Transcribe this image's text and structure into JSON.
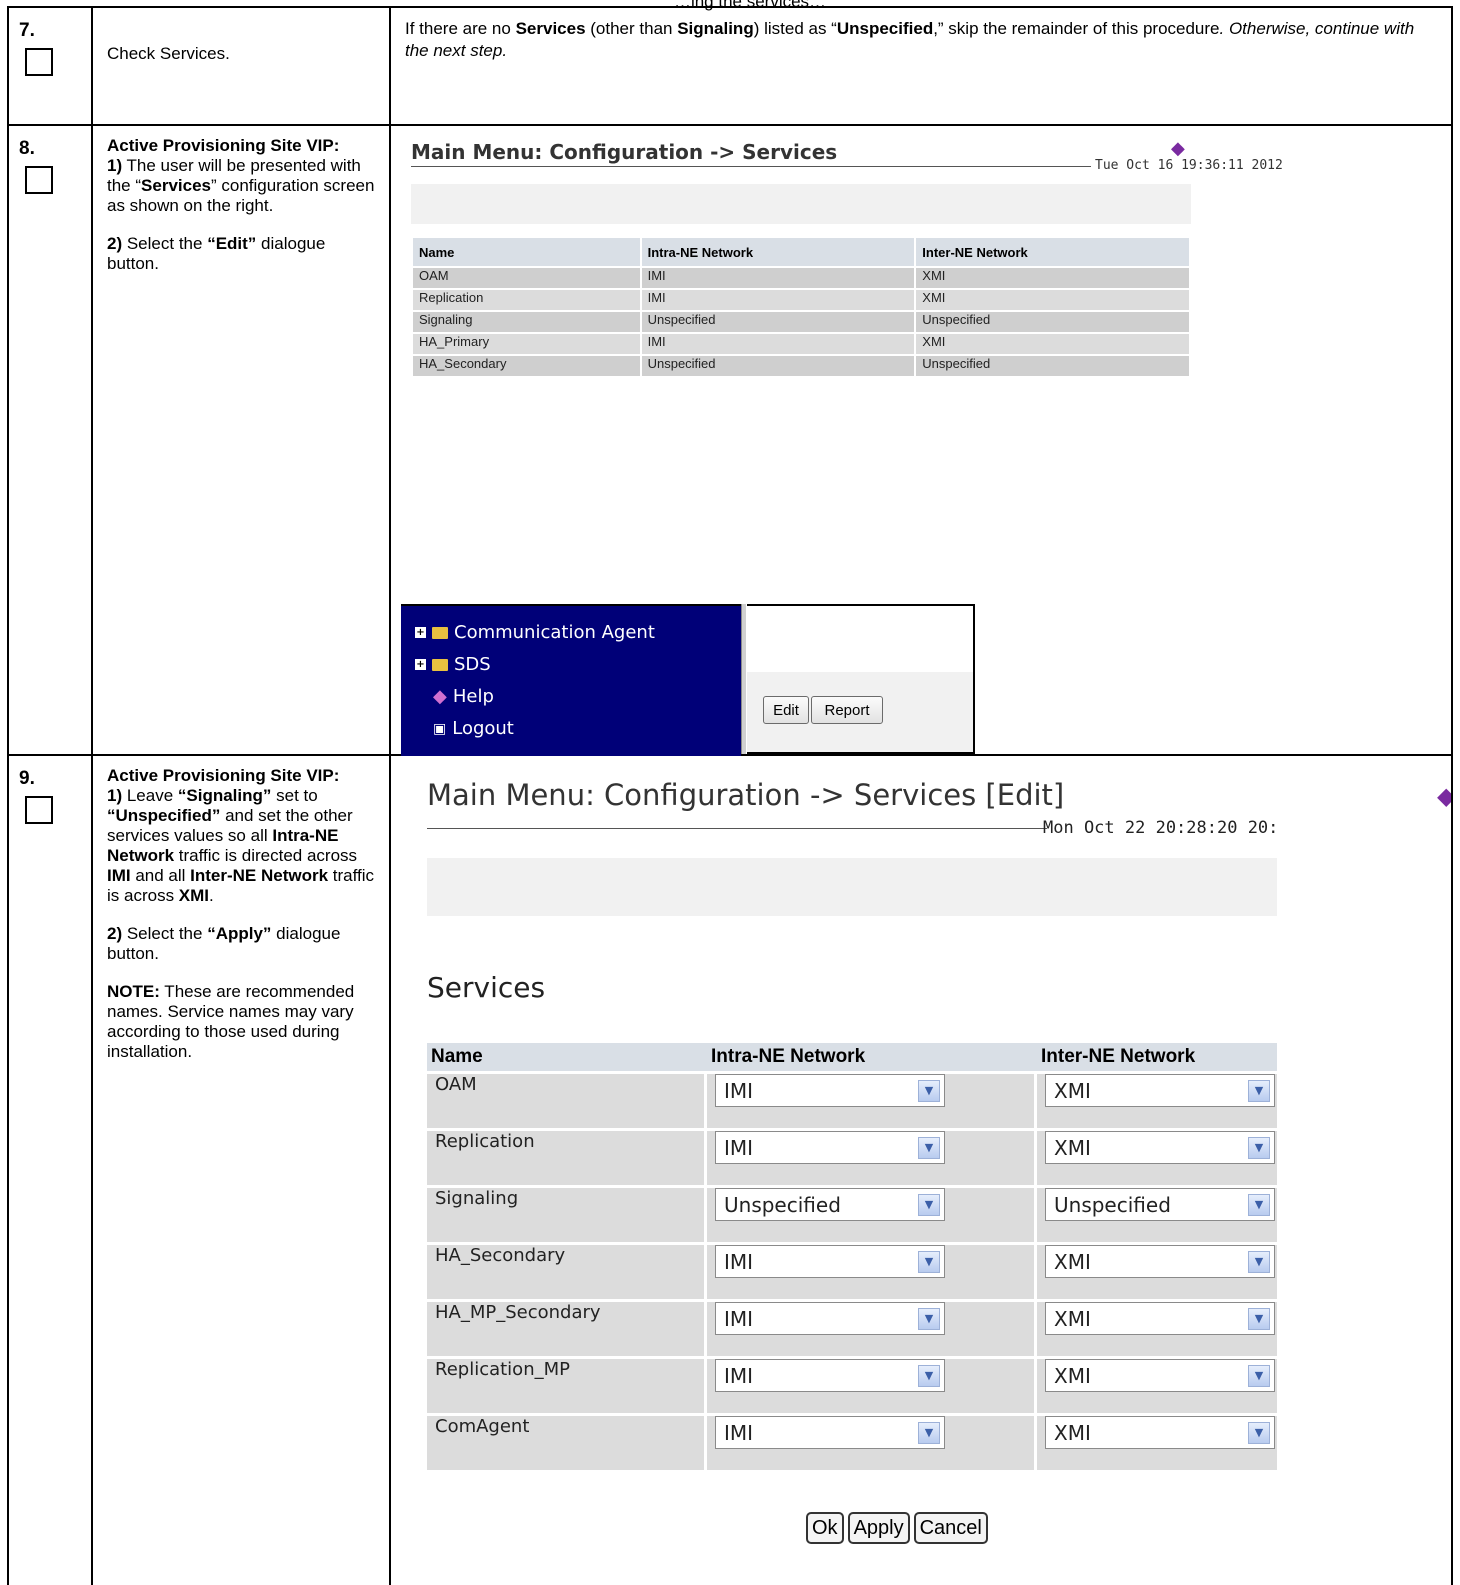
{
  "partial_top": "…ing the services…",
  "steps": [
    {
      "num": "7.",
      "title": "Check Services.",
      "desc_parts": [
        "If there are no ",
        "Services",
        " (other than ",
        "Signaling",
        ") listed as “",
        "Unspecified",
        ",” skip the remainder of this procedure",
        ". Otherwise, continue with the next step."
      ]
    },
    {
      "num": "8.",
      "heading": "Active Provisioning Site VIP:",
      "i1": [
        "1)",
        " The user will be presented with the “",
        "Services",
        "” configuration screen as shown on the right."
      ],
      "i2": [
        "2)",
        " Select the ",
        "“Edit”",
        " dialogue button."
      ]
    },
    {
      "num": "9.",
      "heading": "Active Provisioning Site VIP:",
      "i1": [
        "1)",
        " Leave ",
        "“Signaling”",
        " set to ",
        "“Unspecified”",
        " and set the other services values so all ",
        "Intra-NE Network",
        " traffic is directed across ",
        "IMI",
        " and all ",
        "Inter-NE Network",
        " traffic is across ",
        "XMI",
        "."
      ],
      "i2": [
        "2)",
        " Select the ",
        "“Apply”",
        " dialogue button."
      ],
      "note": [
        "NOTE:",
        " These are recommended names. Service names may vary according to those used during installation."
      ]
    }
  ],
  "ss8": {
    "title": "Main Menu: Configuration -> Services",
    "timestamp": "Tue Oct 16 19:36:11 2012",
    "headers": [
      "Name",
      "Intra-NE Network",
      "Inter-NE Network"
    ],
    "rows": [
      [
        "OAM",
        "IMI",
        "XMI"
      ],
      [
        "Replication",
        "IMI",
        "XMI"
      ],
      [
        "Signaling",
        "Unspecified",
        "Unspecified"
      ],
      [
        "HA_Primary",
        "IMI",
        "XMI"
      ],
      [
        "HA_Secondary",
        "Unspecified",
        "Unspecified"
      ]
    ],
    "tree": [
      "Communication Agent",
      "SDS",
      "Help",
      "Logout"
    ],
    "buttons": [
      "Edit",
      "Report"
    ]
  },
  "ss9": {
    "title": "Main Menu: Configuration -> Services [Edit]",
    "timestamp": "Mon Oct 22 20:28:20 20:",
    "section": "Services",
    "headers": [
      "Name",
      "Intra-NE Network",
      "Inter-NE Network"
    ],
    "rows": [
      [
        "OAM",
        "IMI",
        "XMI"
      ],
      [
        "Replication",
        "IMI",
        "XMI"
      ],
      [
        "Signaling",
        "Unspecified",
        "Unspecified"
      ],
      [
        "HA_Secondary",
        "IMI",
        "XMI"
      ],
      [
        "HA_MP_Secondary",
        "IMI",
        "XMI"
      ],
      [
        "Replication_MP",
        "IMI",
        "XMI"
      ],
      [
        "ComAgent",
        "IMI",
        "XMI"
      ]
    ],
    "buttons": [
      "Ok",
      "Apply",
      "Cancel"
    ]
  },
  "colors": {
    "tree_bg": "#000078",
    "header_bg": "#d9dfe6",
    "row_bg": "#dcdcdc"
  }
}
